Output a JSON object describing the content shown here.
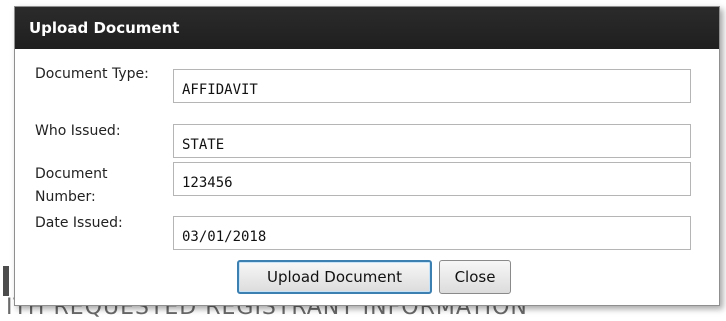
{
  "dialog": {
    "title": "Upload Document",
    "fields": [
      {
        "label": "Document Type:",
        "value": "AFFIDAVIT"
      },
      {
        "label": "Who Issued:",
        "value": "STATE"
      },
      {
        "label": "Document Number:",
        "value": "123456"
      },
      {
        "label": "Date Issued:",
        "value": "03/01/2018"
      }
    ],
    "buttons": {
      "upload_label": "Upload Document",
      "close_label": "Close"
    }
  },
  "background": {
    "partial_text": "ITH REQUESTED REGISTRANT INFORMATION"
  }
}
